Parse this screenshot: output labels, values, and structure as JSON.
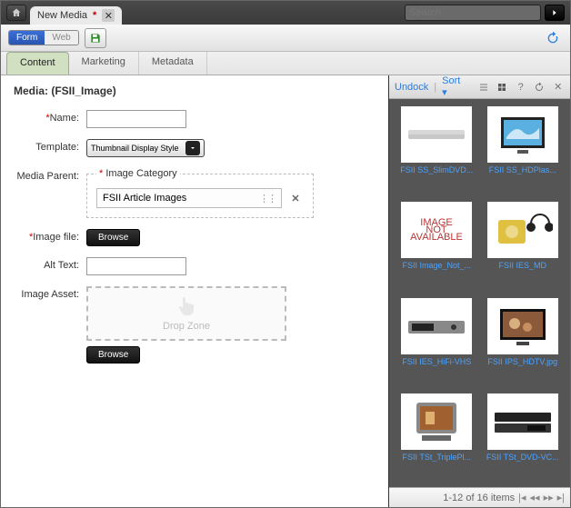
{
  "topbar": {
    "tab_title": "New Media",
    "search_placeholder": "Search"
  },
  "toolbar": {
    "mode_form": "Form",
    "mode_web": "Web"
  },
  "subtabs": {
    "content": "Content",
    "marketing": "Marketing",
    "metadata": "Metadata"
  },
  "form": {
    "heading": "Media: (FSII_Image)",
    "name_label": "Name:",
    "template_label": "Template:",
    "template_value": "Thumbnail Display Style",
    "media_parent_label": "Media Parent:",
    "image_category_label": "Image Category",
    "image_category_value": "FSII Article Images",
    "image_file_label": "Image file:",
    "browse_label": "Browse",
    "alt_text_label": "Alt Text:",
    "image_asset_label": "Image Asset:",
    "dropzone_text": "Drop Zone"
  },
  "rightpanel": {
    "undock": "Undock",
    "sort": "Sort",
    "status_count": "1-12 of 16 items",
    "thumbs": [
      {
        "label": "FSII SS_SlimDVD..."
      },
      {
        "label": "FSII SS_HDPlas..."
      },
      {
        "label": "FSII Image_Not_..."
      },
      {
        "label": "FSII IES_MD"
      },
      {
        "label": "FSII IES_HiFi-VHS"
      },
      {
        "label": "FSII IPS_HDTV.jpg"
      },
      {
        "label": "FSII TSt_TriplePl..."
      },
      {
        "label": "FSII TSt_DVD-VC..."
      }
    ]
  }
}
